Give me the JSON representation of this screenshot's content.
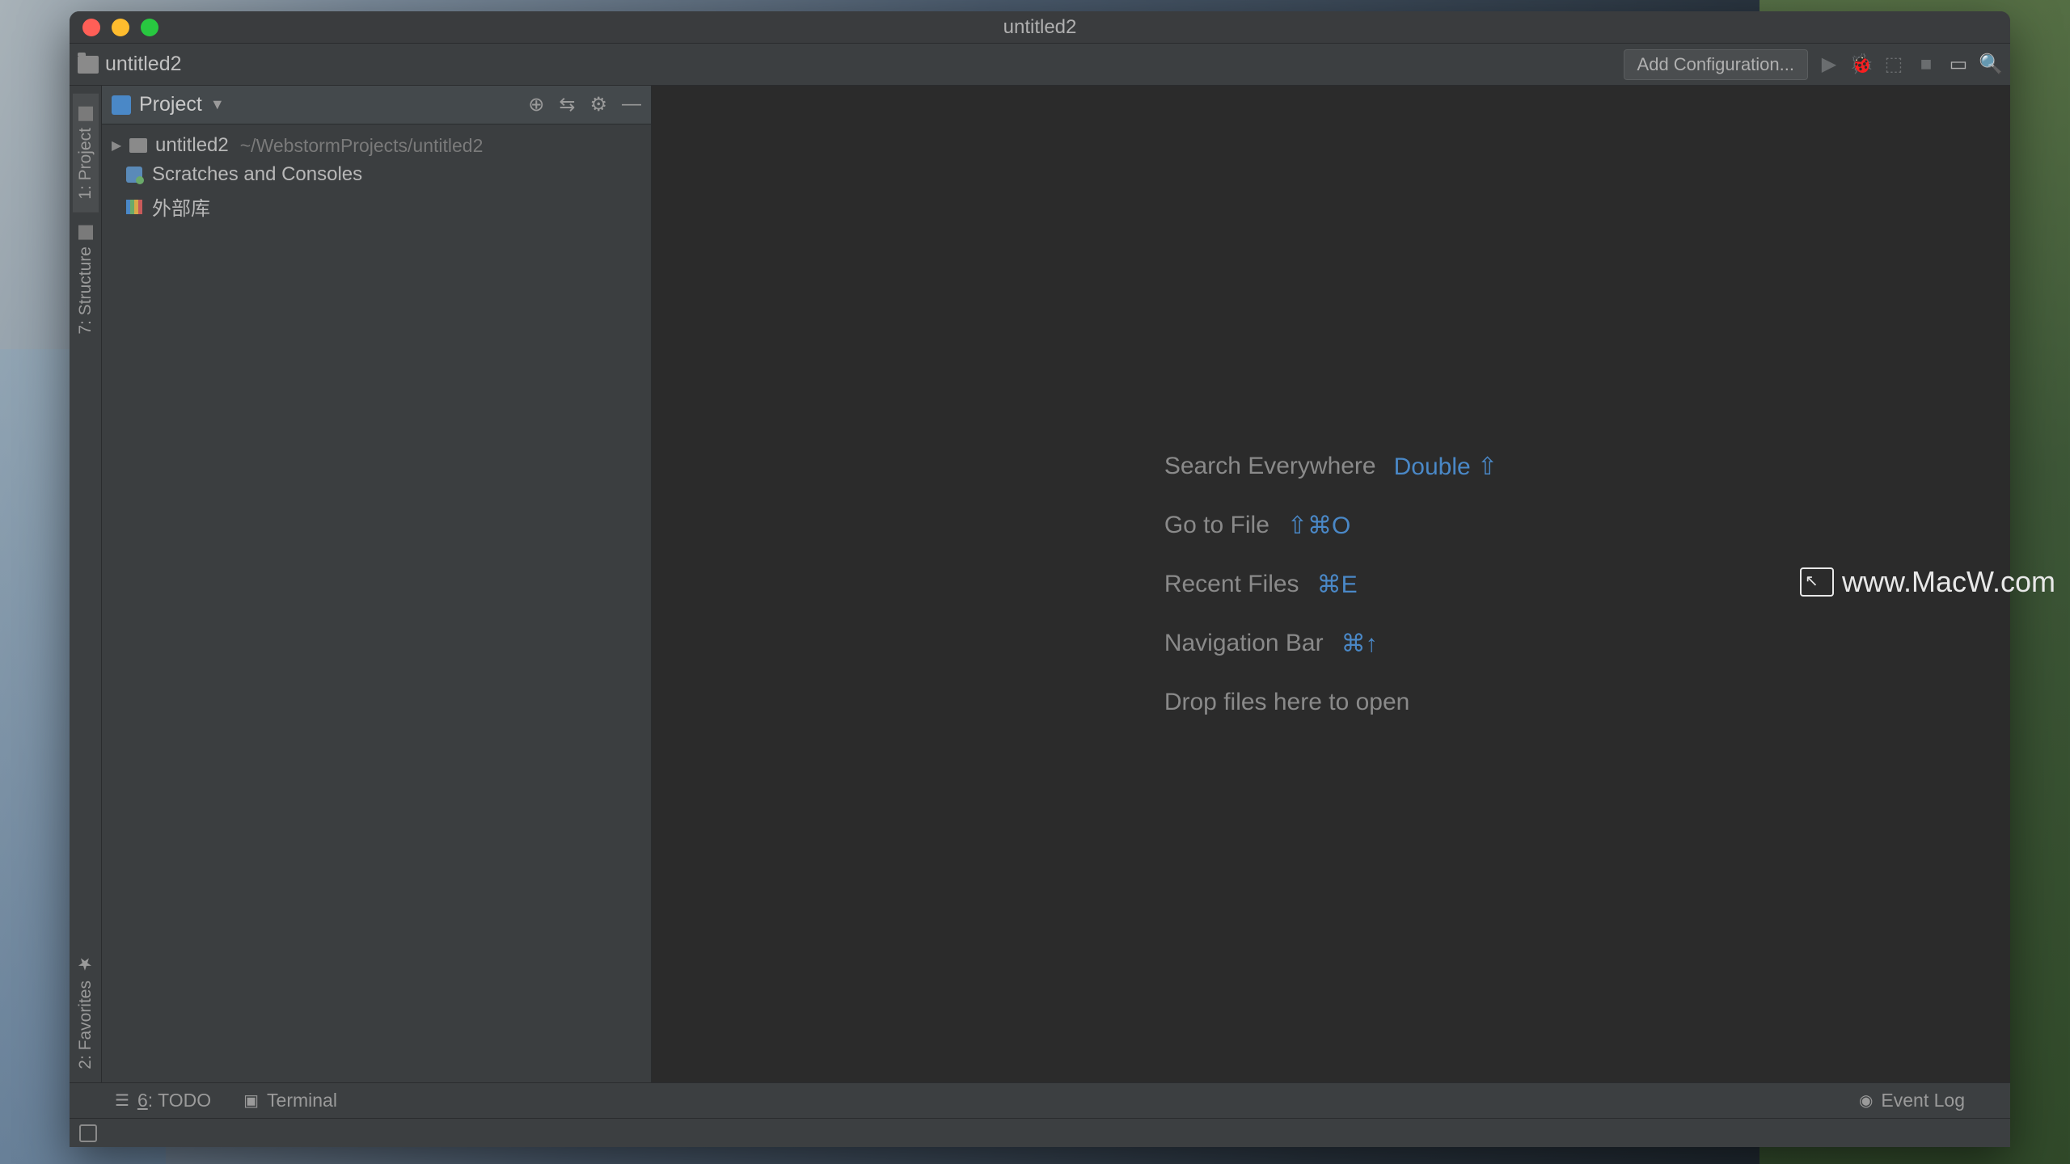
{
  "window": {
    "title": "untitled2"
  },
  "navbar": {
    "project_name": "untitled2",
    "add_config": "Add Configuration..."
  },
  "left_gutter": {
    "project": "1: Project",
    "structure": "7: Structure",
    "favorites": "2: Favorites"
  },
  "sidebar": {
    "title": "Project",
    "tree": {
      "root_name": "untitled2",
      "root_path": "~/WebstormProjects/untitled2",
      "scratches": "Scratches and Consoles",
      "external_lib": "外部库"
    }
  },
  "welcome": {
    "search_label": "Search Everywhere",
    "search_shortcut": "Double ⇧",
    "goto_label": "Go to File",
    "goto_shortcut": "⇧⌘O",
    "recent_label": "Recent Files",
    "recent_shortcut": "⌘E",
    "navbar_label": "Navigation Bar",
    "navbar_shortcut": "⌘↑",
    "drop_label": "Drop files here to open"
  },
  "bottombar": {
    "todo": "6: TODO",
    "terminal": "Terminal",
    "event_log": "Event Log"
  },
  "watermark": "www.MacW.com"
}
